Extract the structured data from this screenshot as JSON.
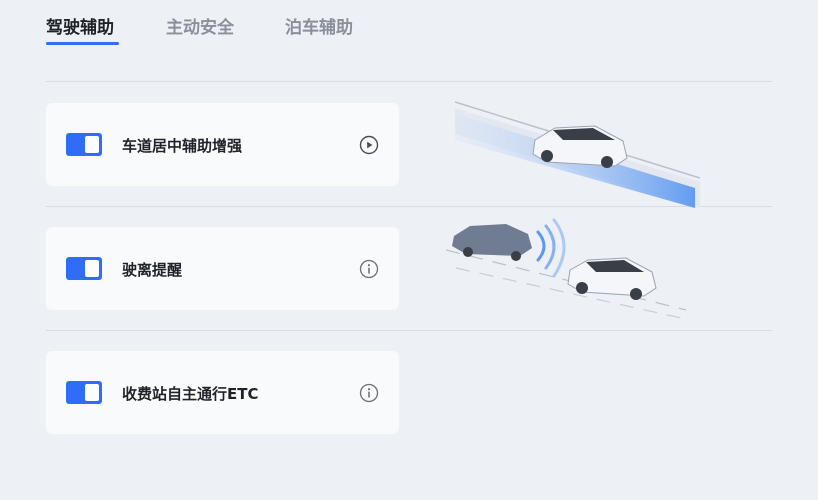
{
  "tabs": [
    {
      "label": "驾驶辅助",
      "active": true
    },
    {
      "label": "主动安全",
      "active": false
    },
    {
      "label": "泊车辅助",
      "active": false
    }
  ],
  "settings": [
    {
      "label": "车道居中辅助增强",
      "enabled": true,
      "action_icon": "play-icon"
    },
    {
      "label": "驶离提醒",
      "enabled": true,
      "action_icon": "info-icon"
    },
    {
      "label": "收费站自主通行ETC",
      "enabled": true,
      "action_icon": "info-icon"
    }
  ],
  "colors": {
    "accent": "#2f6df6",
    "background": "#edf0f5",
    "card": "#f9fafc"
  }
}
